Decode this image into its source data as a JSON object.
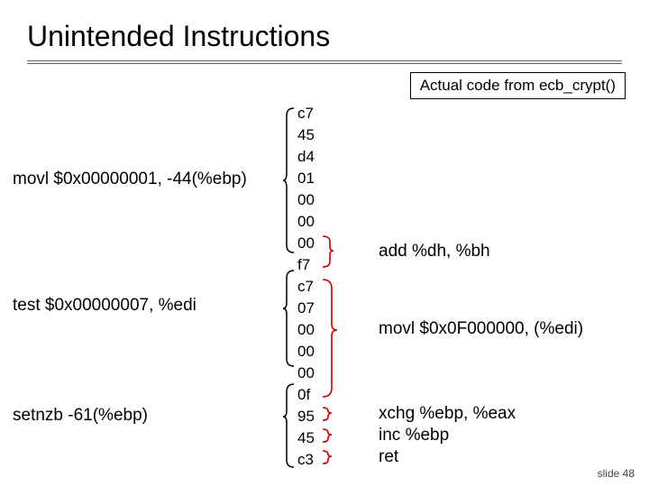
{
  "title": "Unintended Instructions",
  "source_label": "Actual code from ecb_crypt()",
  "left_instructions": {
    "i1": "movl $0x00000001, -44(%ebp)",
    "i2": "test $0x00000007, %edi",
    "i3": "setnzb -61(%ebp)"
  },
  "bytes": [
    "c7",
    "45",
    "d4",
    "01",
    "00",
    "00",
    "00",
    "f7",
    "c7",
    "07",
    "00",
    "00",
    "00",
    "0f",
    "95",
    "45",
    "c3"
  ],
  "right_instructions": {
    "r1": "add %dh, %bh",
    "r2": "movl $0x0F000000, (%edi)",
    "r3": "xchg %ebp, %eax",
    "r4": "inc %ebp",
    "r5": "ret"
  },
  "slide_number": "slide 48"
}
